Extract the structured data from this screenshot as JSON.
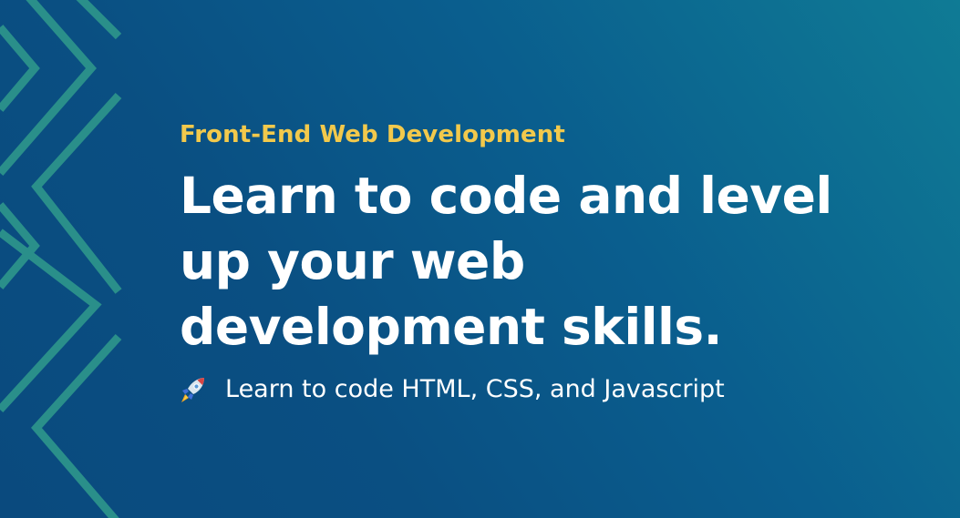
{
  "hero": {
    "eyebrow": "Front-End Web Development",
    "headline": "Learn to code and level up your web development skills.",
    "feature": {
      "icon": "rocket-icon",
      "text": "Learn to code HTML, CSS, and Javascript"
    }
  },
  "colors": {
    "background_dark": "#0a4a7e",
    "background_light": "#0f7b95",
    "accent": "#f2c94c",
    "chevron": "#2a8f8a",
    "text": "#ffffff"
  }
}
